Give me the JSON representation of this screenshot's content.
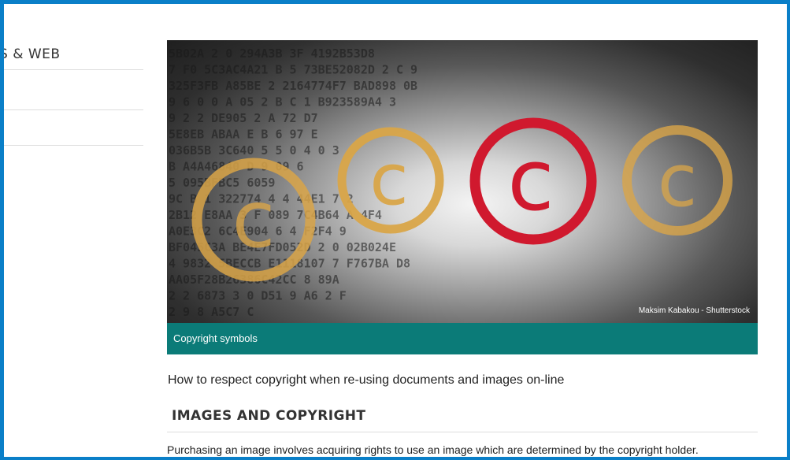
{
  "sidebar": {
    "heading": "S & WEB"
  },
  "hero": {
    "credit": "Maksim Kabakou - Shutterstock",
    "caption": "Copyright symbols",
    "colors": {
      "gold": "#d9a548",
      "red": "#d0192e",
      "teal": "#0b7b78"
    },
    "background_strings": [
      "5B02A   2   0  294A3B  3F   4192B53D8",
      "7 F0 5C3AC4A21  B 5   73BE52082D 2  C   9",
      "  325F3FB A85BE  2 2164774F7 BAD898 0B",
      "  9 6 0 0   A 05 2 B  C 1 B923589A4 3",
      "   9 2   2   DE905  2  A 72 D7",
      "5E8EB  ABAA E B 6 97  E",
      "036B5B  3C640 5 5  0 4  0 3",
      " B A4A46840  D  9 09  6",
      "5 095BFBC5 6059",
      "  9C B 1 322774  4 4 44E1  7 2",
      " 2B12 E8AA 3 F 089  7C4B64   A 4F4",
      "  A0E3C2  6C4E904 6  4 F2F4  9",
      " BF045C3A   BE4E7FD052D  2 0 02B024E",
      " 4  9832   5BECCB E1118107  7 F767BA D8",
      "  AA05F28B26386C42CC   8  89A",
      " 2 2   6873 3 0 D51     9 A6 2 F",
      "  2 9  8 A5C7   C"
    ]
  },
  "content": {
    "intro": "How to respect copyright when re-using documents and images on-line",
    "section_title": "IMAGES AND COPYRIGHT",
    "paragraph": "Purchasing an image involves acquiring rights to use an image which are determined by the copyright holder."
  },
  "frame": {
    "color": "#0a7fc8"
  }
}
